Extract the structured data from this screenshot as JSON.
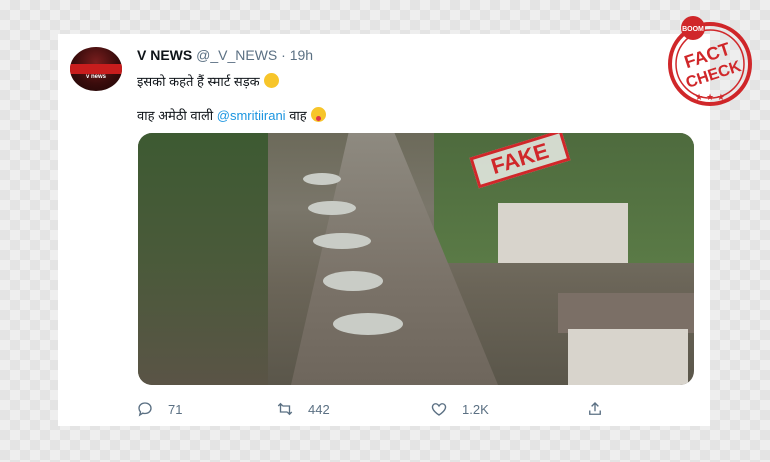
{
  "tweet": {
    "account_name": "V NEWS",
    "handle": "@_V_NEWS",
    "separator": "·",
    "time": "19h",
    "avatar_text": "v news",
    "line1": "इसको कहते हैं स्मार्ट सड़क",
    "line2_prefix": "वाह अमेठी वाली",
    "mention": "@smritiirani",
    "line2_suffix": "वाह"
  },
  "overlay": {
    "fake_label": "FAKE"
  },
  "actions": {
    "replies": "71",
    "retweets": "442",
    "likes": "1.2K"
  },
  "stamp": {
    "top_text": "BOOM",
    "word1": "FACT",
    "word2": "CHECK",
    "accent": "#d0272a"
  },
  "icons": [
    "reply-icon",
    "retweet-icon",
    "like-icon",
    "share-icon",
    "laughing-emoji",
    "tongue-emoji"
  ]
}
